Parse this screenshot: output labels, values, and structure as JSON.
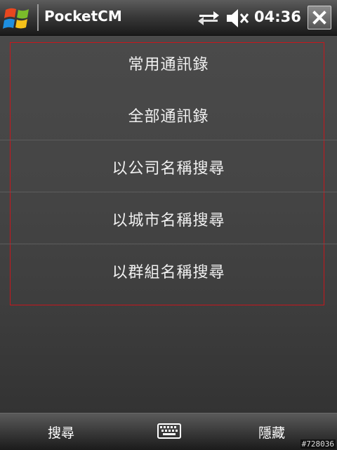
{
  "status_bar": {
    "app_title": "PocketCM",
    "time": "04:36",
    "icons": [
      "windows-start-icon",
      "sync-icon",
      "volume-mute-icon",
      "close-icon"
    ]
  },
  "menu": {
    "items": [
      {
        "label": "常用通訊錄"
      },
      {
        "label": "全部通訊錄"
      },
      {
        "label": "以公司名稱搜尋"
      },
      {
        "label": "以城市名稱搜尋"
      },
      {
        "label": "以群組名稱搜尋"
      }
    ]
  },
  "softkeys": {
    "left": "搜尋",
    "right": "隱藏",
    "center_icon": "keyboard-icon"
  },
  "watermark": "#728036",
  "colors": {
    "highlight_border": "#c8161c",
    "background": "#3c3c3c"
  }
}
